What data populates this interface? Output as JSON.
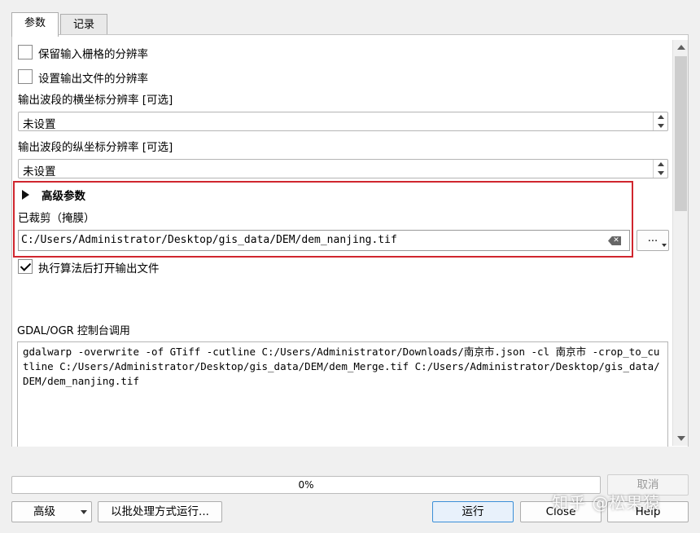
{
  "tabs": [
    {
      "label": "参数",
      "active": true
    },
    {
      "label": "记录",
      "active": false
    }
  ],
  "params": {
    "keep_resolution": {
      "label": "保留输入栅格的分辨率",
      "checked": false
    },
    "set_resolution": {
      "label": "设置输出文件的分辨率",
      "checked": false
    },
    "x_res": {
      "label": "输出波段的横坐标分辨率 [可选]",
      "value": "未设置"
    },
    "y_res": {
      "label": "输出波段的纵坐标分辨率 [可选]",
      "value": "未设置"
    },
    "advanced_header": "高级参数",
    "clipped": {
      "label": "已裁剪（掩膜）",
      "value": "C:/Users/Administrator/Desktop/gis_data/DEM/dem_nanjing.tif",
      "browse_label": "..."
    },
    "open_output": {
      "label": "执行算法后打开输出文件",
      "checked": true
    }
  },
  "console": {
    "label": "GDAL/OGR 控制台调用",
    "text": "gdalwarp -overwrite -of GTiff -cutline C:/Users/Administrator/Downloads/南京市.json -cl 南京市 -crop_to_cutline C:/Users/Administrator/Desktop/gis_data/DEM/dem_Merge.tif C:/Users/Administrator/Desktop/gis_data/DEM/dem_nanjing.tif"
  },
  "progress": {
    "text": "0%",
    "value": 0
  },
  "buttons": {
    "cancel": "取消",
    "advanced": "高级",
    "batch": "以批处理方式运行...",
    "run": "运行",
    "close": "Close",
    "help": "Help"
  },
  "watermark": "知乎 @松果猿",
  "colors": {
    "highlight_box": "#d0262e",
    "run_border": "#3b8fd8"
  }
}
